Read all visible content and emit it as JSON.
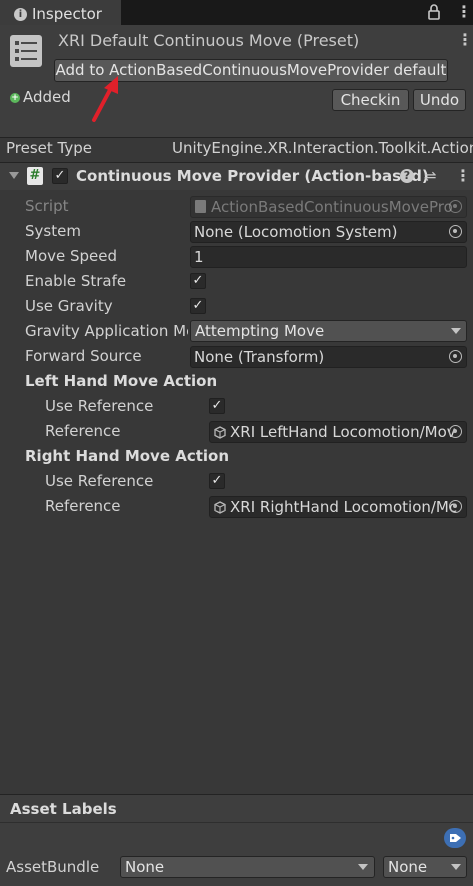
{
  "tab": {
    "label": "Inspector"
  },
  "preset": {
    "title": "XRI Default Continuous Move (Preset)",
    "add_default_button": "Add to ActionBasedContinuousMoveProvider default",
    "status": "Added",
    "checkin_button": "Checkin",
    "undo_button": "Undo"
  },
  "preset_type": {
    "label": "Preset Type",
    "value": "UnityEngine.XR.Interaction.Toolkit.ActionI"
  },
  "component": {
    "title": "Continuous Move Provider (Action-based)",
    "script_label": "Script",
    "script_value": "ActionBasedContinuousMovePro",
    "system_label": "System",
    "system_value": "None (Locomotion System)",
    "move_speed_label": "Move Speed",
    "move_speed_value": "1",
    "enable_strafe_label": "Enable Strafe",
    "use_gravity_label": "Use Gravity",
    "gravity_mode_label": "Gravity Application Mc",
    "gravity_mode_value": "Attempting Move",
    "forward_source_label": "Forward Source",
    "forward_source_value": "None (Transform)",
    "left_hand_header": "Left Hand Move Action",
    "left_use_reference_label": "Use Reference",
    "left_reference_label": "Reference",
    "left_reference_value": "XRI LeftHand Locomotion/Mov",
    "right_hand_header": "Right Hand Move Action",
    "right_use_reference_label": "Use Reference",
    "right_reference_label": "Reference",
    "right_reference_value": "XRI RightHand Locomotion/Mc"
  },
  "asset_labels": {
    "header": "Asset Labels",
    "assetbundle_label": "AssetBundle",
    "assetbundle_value": "None",
    "variant_value": "None"
  },
  "colors": {
    "accent_arrow": "#e0202a",
    "added_dot": "#5cb85c",
    "tag_icon": "#3d6fb4"
  }
}
